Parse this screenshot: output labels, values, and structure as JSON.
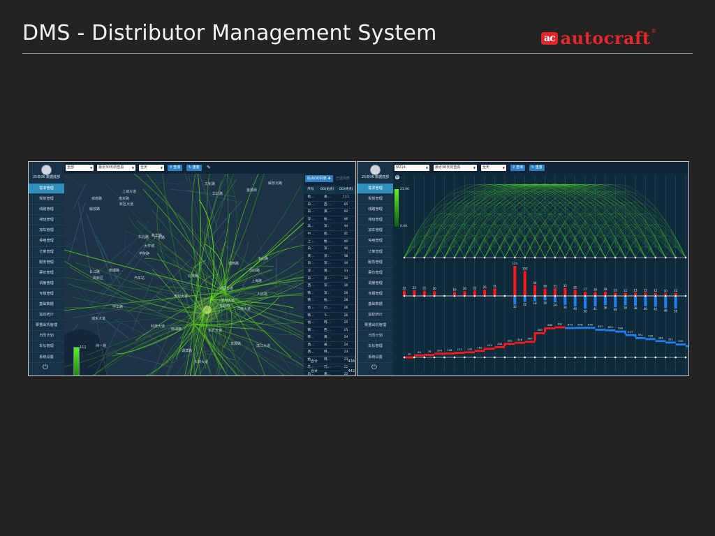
{
  "slide": {
    "title": "DMS - Distributor Management System",
    "logo_mark": "ac",
    "logo_text": "autocraft",
    "logo_reg": "®"
  },
  "colors": {
    "accent": "#2e7fbf",
    "flow_green": "#52e81b",
    "inbound_red": "#ff1616",
    "outbound_blue": "#1f7ef0",
    "brand_red": "#e4262b"
  },
  "left_app": {
    "user_label": "25年06 数据底部",
    "menu": [
      "需求管理",
      "规划管理",
      "线路管理",
      "排班管理",
      "加车管理",
      "停用管理",
      "订单管理",
      "服务管理",
      "票价管理",
      "调度管理",
      "专题管理",
      "基础数据",
      "监控统计",
      "票据出机管理",
      "日历计划",
      "车长管理",
      "系统设置"
    ],
    "active_menu_index": 0,
    "filters": {
      "area": "全部",
      "period": "最近30天的查看",
      "day_type": "全天"
    },
    "buttons": {
      "query": "查询",
      "reset": "重置"
    },
    "legend": {
      "max": "111",
      "min": "0"
    },
    "map_labels": [
      "城区大道",
      "上海路",
      "纬一路",
      "上城大道",
      "广州路",
      "发展路",
      "城东大道",
      "华北路",
      "东北路",
      "东城大道",
      "解放路",
      "长江路",
      "城南路",
      "滨江大道",
      "科技大道",
      "中山路",
      "世纪大道",
      "北京路",
      "新华路",
      "中华路",
      "解放北路",
      "金融街",
      "学院路",
      "人民路",
      "文化路",
      "南京路",
      "滨河大道",
      "高新区",
      "新区大道",
      "城西路",
      "湖滨路",
      "东方大道",
      "大学城",
      "汽车站",
      "创业路",
      "江南大道",
      "铁路南",
      "南湖路",
      "西湖路"
    ],
    "table": {
      "tab_button": "始点OD列表",
      "tab_link": "已选列表",
      "headers": [
        "序号",
        "OD(始点)",
        "OD(终点)"
      ],
      "rows": [
        [
          "始...",
          "黄...",
          "111"
        ],
        [
          "白...",
          "西...",
          "65"
        ],
        [
          "白...",
          "黄...",
          "62"
        ],
        [
          "深...",
          "始...",
          "46"
        ],
        [
          "高...",
          "深...",
          "44"
        ],
        [
          "中...",
          "始...",
          "41"
        ],
        [
          "上...",
          "始...",
          "40"
        ],
        [
          "白...",
          "深...",
          "40"
        ],
        [
          "黄...",
          "深...",
          "38"
        ],
        [
          "白...",
          "深...",
          "34"
        ],
        [
          "深...",
          "黄...",
          "33"
        ],
        [
          "白...",
          "深...",
          "32"
        ],
        [
          "西...",
          "深...",
          "30"
        ],
        [
          "韩...",
          "深...",
          "28"
        ],
        [
          "韩...",
          "始...",
          "28"
        ],
        [
          "始...",
          "25...",
          "26"
        ],
        [
          "韩...",
          "5...",
          "26"
        ],
        [
          "福...",
          "韩...",
          "25"
        ],
        [
          "韩...",
          "西...",
          "25"
        ],
        [
          "韩...",
          "黄...",
          "24"
        ],
        [
          "西...",
          "黄...",
          "24"
        ],
        [
          "西...",
          "韩...",
          "23"
        ],
        [
          "始...",
          "韩...",
          "23"
        ],
        [
          "韩...",
          "韩...",
          "22"
        ],
        [
          "白...",
          "黄...",
          "22"
        ]
      ],
      "total_label_1": "合计",
      "total_value_1": "436",
      "total_label_2": "合计",
      "total_value_2": "442"
    }
  },
  "right_app": {
    "user_label": "25年06 数据底部",
    "menu": [
      "需求管理",
      "规划管理",
      "线路管理",
      "排班管理",
      "加车管理",
      "停用管理",
      "订单管理",
      "服务管理",
      "票价管理",
      "调度管理",
      "专题管理",
      "基础数据",
      "监控统计",
      "票据出机管理",
      "日历计划",
      "车长管理",
      "系统设置"
    ],
    "active_menu_index": 0,
    "filters": {
      "route": "M214",
      "period": "最近30天的查看",
      "day_type": "全天"
    },
    "buttons": {
      "query": "查询",
      "reset": "重置"
    },
    "scale": {
      "max": "21.00",
      "min": "0.00"
    },
    "chart_data": {
      "type": "bar",
      "stop_count": 29,
      "boarding": [
        22,
        23,
        21,
        20,
        null,
        16,
        20,
        22,
        26,
        31,
        null,
        124,
        103,
        44,
        30,
        31,
        32,
        25,
        17,
        16,
        18,
        13,
        12,
        13,
        13,
        12,
        10,
        12,
        null
      ],
      "alighting": [
        null,
        null,
        null,
        null,
        null,
        null,
        null,
        null,
        null,
        null,
        null,
        32,
        22,
        18,
        16,
        24,
        34,
        40,
        50,
        41,
        36,
        44,
        36,
        38,
        40,
        42,
        48,
        50,
        null
      ],
      "load": [
        20,
        65,
        76,
        104,
        108,
        121,
        133,
        165,
        214,
        250,
        322,
        346,
        367,
        560,
        668,
        691,
        673,
        678,
        678,
        637,
        623,
        596,
        517,
        451,
        428,
        384,
        351,
        309,
        272
      ]
    }
  }
}
